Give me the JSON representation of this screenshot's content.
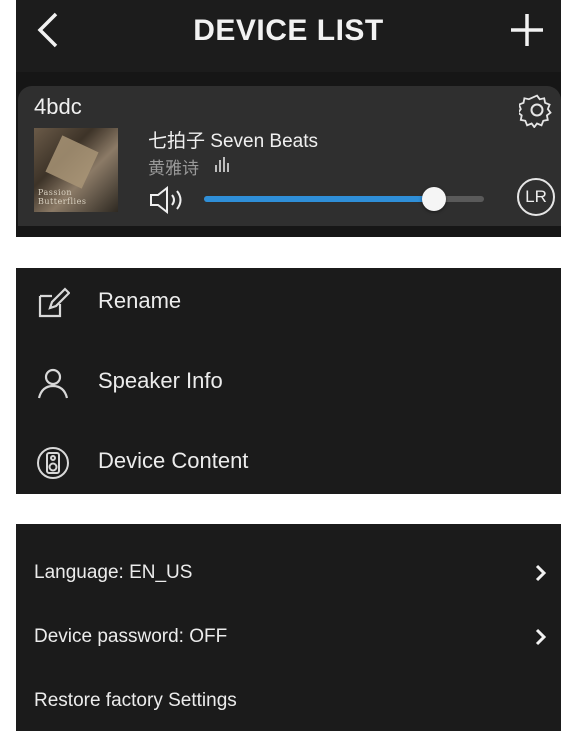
{
  "header": {
    "title": "DEVICE LIST",
    "back_icon": "chevron-left-icon",
    "add_icon": "plus-icon"
  },
  "device": {
    "name": "4bdc",
    "song": "七拍子  Seven Beats",
    "artist": "黄雅诗",
    "cover_text": "Passion Butterflies",
    "volume": 0.82,
    "channel": "LR",
    "accent": "#2f8fd8"
  },
  "menu": [
    {
      "label": "Rename",
      "icon": "edit-icon"
    },
    {
      "label": "Speaker Info",
      "icon": "person-icon"
    },
    {
      "label": "Device Content",
      "icon": "speaker-box-icon"
    }
  ],
  "settings": [
    {
      "label": "Language: EN_US",
      "chevron": true
    },
    {
      "label": "Device password: OFF",
      "chevron": true
    },
    {
      "label": "Restore factory Settings",
      "chevron": false
    }
  ]
}
